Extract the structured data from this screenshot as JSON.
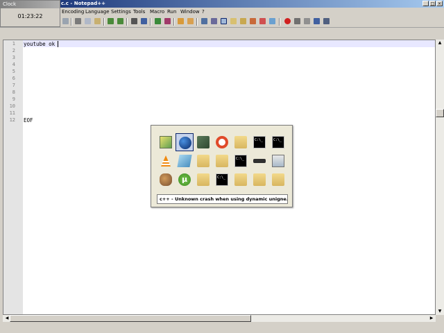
{
  "window": {
    "title": "c.c - Notepad++"
  },
  "clock": {
    "title": "Clock",
    "time": "01:23:22"
  },
  "menu": [
    "Encoding",
    "Language",
    "Settings",
    "Tools",
    "Macro",
    "Run",
    "Window",
    "?"
  ],
  "editor": {
    "line_numbers": [
      "1",
      "2",
      "3",
      "4",
      "5",
      "6",
      "7",
      "8",
      "9",
      "10",
      "11",
      "12"
    ],
    "lines": [
      "youtube ok",
      "",
      "",
      "",
      "",
      "",
      "",
      "",
      "",
      "",
      "",
      "EOF"
    ]
  },
  "switcher": {
    "caption": "c++ - Unknown crash when using dynamic unigne...",
    "apps": [
      "paint-icon",
      "globe-icon",
      "network-icon",
      "lifebuoy-icon",
      "folder-icon",
      "terminal-icon",
      "terminal-icon",
      "vlc-icon",
      "notepad-icon",
      "folder-icon",
      "folder-icon",
      "terminal-icon",
      "usb-drive-icon",
      "control-panel-icon",
      "gimp-icon",
      "utorrent-icon",
      "folder-icon",
      "terminal-icon",
      "folder-icon",
      "folder-icon",
      "folder-icon"
    ],
    "selected_index": 1
  }
}
